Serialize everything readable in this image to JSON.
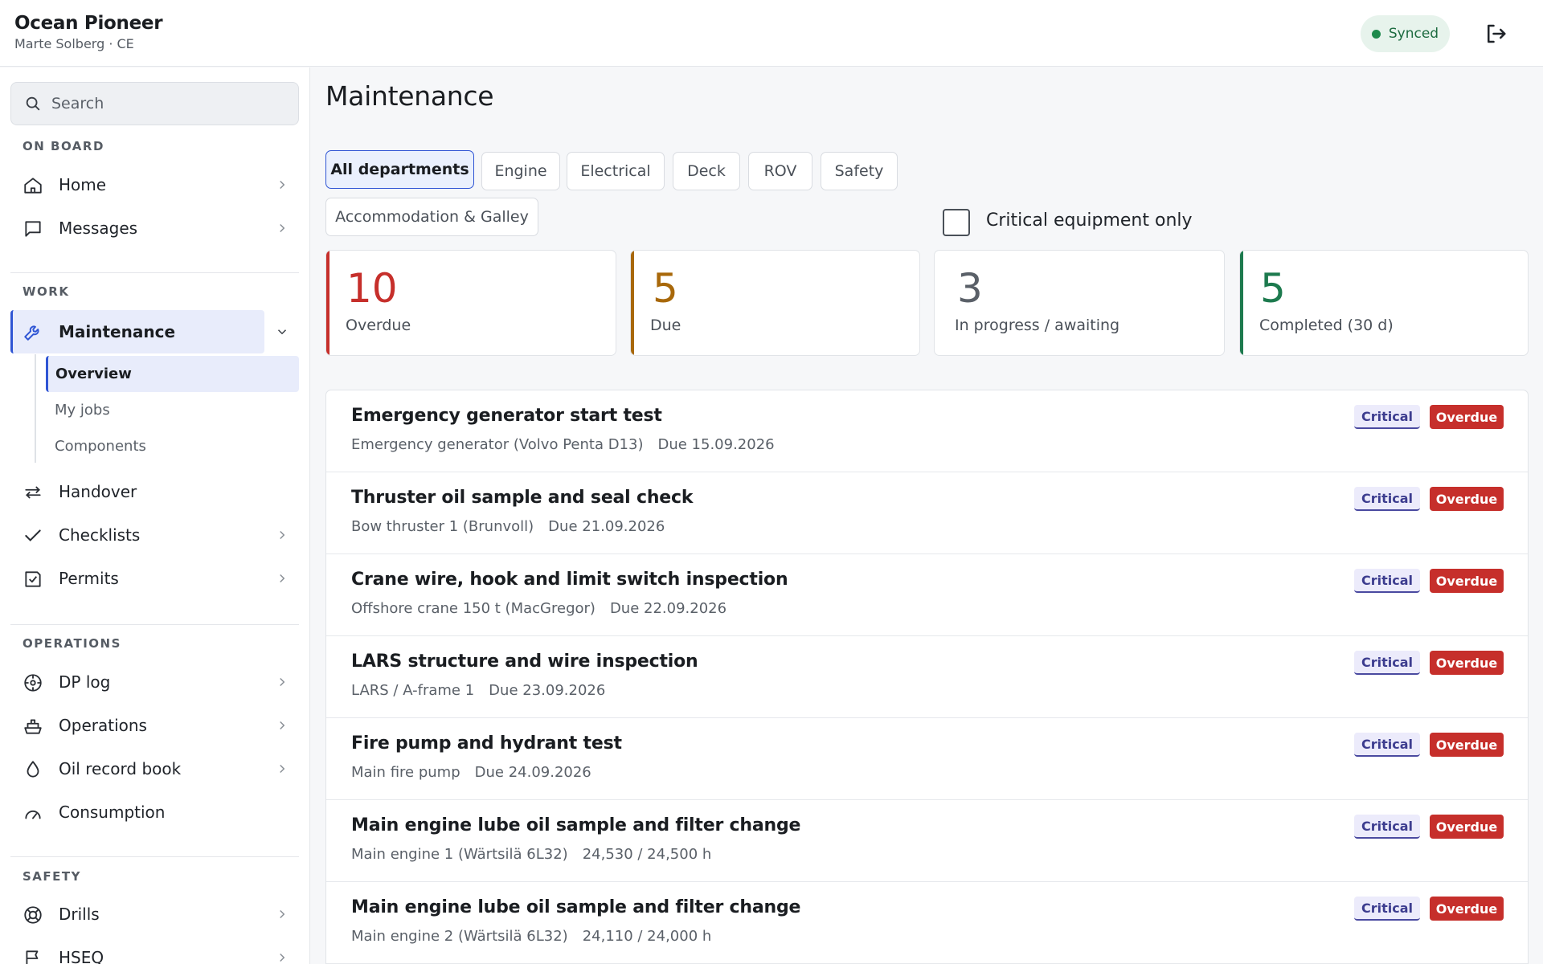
{
  "header": {
    "vessel_name": "Ocean Pioneer",
    "user": "Marte Solberg · CE",
    "sync_status": "Synced",
    "sync_color": "#1e8a4c",
    "logout_icon": "logout-icon"
  },
  "sidebar": {
    "search_placeholder": "Search",
    "sections": {
      "on_board": "ON BOARD",
      "work": "WORK",
      "operations": "OPERATIONS",
      "safety": "SAFETY"
    },
    "items": {
      "home": "Home",
      "messages": "Messages",
      "maintenance": "Maintenance",
      "handover": "Handover",
      "checklists": "Checklists",
      "permits": "Permits",
      "dp_log": "DP log",
      "operations": "Operations",
      "oil_record_book": "Oil record book",
      "consumption": "Consumption",
      "drills": "Drills",
      "hseq": "HSEQ"
    },
    "maintenance_sub": {
      "overview": "Overview",
      "my_jobs": "My jobs",
      "components": "Components"
    }
  },
  "main": {
    "title": "Maintenance",
    "filters": {
      "all": "All departments",
      "engine": "Engine",
      "electrical": "Electrical",
      "deck": "Deck",
      "rov": "ROV",
      "safety": "Safety",
      "accommodation": "Accommodation & Galley"
    },
    "active_filter": "All departments",
    "critical_only_label": "Critical equipment only",
    "critical_only_checked": false,
    "stats": {
      "overdue": {
        "value": "10",
        "label": "Overdue",
        "color": "#c62f2b"
      },
      "due": {
        "value": "5",
        "label": "Due",
        "color": "#a8680a"
      },
      "in_progress": {
        "value": "3",
        "label": "In progress / awaiting",
        "color": "#5a6068"
      },
      "completed": {
        "value": "5",
        "label": "Completed (30 d)",
        "color": "#1d7a4e"
      }
    },
    "jobs": [
      {
        "title": "Emergency generator start test",
        "component": "Emergency generator (Volvo Penta D13)",
        "detail": "Due 15.09.2026",
        "critical": "Critical",
        "status": "Overdue"
      },
      {
        "title": "Thruster oil sample and seal check",
        "component": "Bow thruster 1 (Brunvoll)",
        "detail": "Due 21.09.2026",
        "critical": "Critical",
        "status": "Overdue"
      },
      {
        "title": "Crane wire, hook and limit switch inspection",
        "component": "Offshore crane 150 t (MacGregor)",
        "detail": "Due 22.09.2026",
        "critical": "Critical",
        "status": "Overdue"
      },
      {
        "title": "LARS structure and wire inspection",
        "component": "LARS / A-frame 1",
        "detail": "Due 23.09.2026",
        "critical": "Critical",
        "status": "Overdue"
      },
      {
        "title": "Fire pump and hydrant test",
        "component": "Main fire pump",
        "detail": "Due 24.09.2026",
        "critical": "Critical",
        "status": "Overdue"
      },
      {
        "title": "Main engine lube oil sample and filter change",
        "component": "Main engine 1 (Wärtsilä 6L32)",
        "detail": "24,530 / 24,500 h",
        "critical": "Critical",
        "status": "Overdue"
      },
      {
        "title": "Main engine lube oil sample and filter change",
        "component": "Main engine 2 (Wärtsilä 6L32)",
        "detail": "24,110 / 24,000 h",
        "critical": "Critical",
        "status": "Overdue"
      }
    ]
  }
}
